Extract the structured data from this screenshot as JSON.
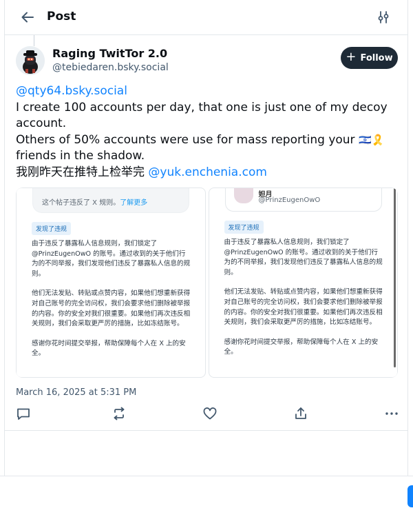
{
  "header": {
    "title": "Post",
    "back_icon": "arrow-left-icon",
    "settings_icon": "sliders-icon"
  },
  "author": {
    "name": "Raging TwitTor 2.0",
    "handle": "@tebiedaren.bsky.social"
  },
  "follow": {
    "label": "Follow"
  },
  "post": {
    "mention_1": "@qty64.bsky.social",
    "line_1": "I create 100 accounts per day, that one is just one of my decoy",
    "line_2": "account.",
    "line_3": "Others of 50% accounts were use for mass reporting your ",
    "flags": "🇮🇱🎗️",
    "line_4": "friends in the shadow.",
    "line_5_prefix": "我刚昨天在推特上检举完 ",
    "mention_2": "@yuk.enchenia.com"
  },
  "images": {
    "left": {
      "notice": "这个帖子违反了 X 规则。",
      "notice_link": "了解更多",
      "tag": "发现了违规",
      "para_1": "由于违反了暴露私人信息规则，我们锁定了 @PrinzEugenOwO 的账号。通过收到的关于他们行为的不同举报，我们发现他们违反了暴露私人信息的规则。",
      "para_2": "他们无法发贴、转贴或点赞内容，如果他们想重新获得对自己账号的完全访问权，我们会要求他们删除被举报的内容。你的安全对我们很重要。如果他们再次违反相关规则，我们会采取更严厉的措施，比如冻结账号。",
      "para_3": "感谢你花时间提交举报，帮助保障每个人在 X 上的安全。"
    },
    "right": {
      "quoted_name": "妲月",
      "quoted_handle": "@PrinzEugenOwO",
      "tag": "发现了违规",
      "para_1": "由于违反了暴露私人信息规则，我们锁定了 @PrinzEugenOwO 的账号。通过收到的关于他们行为的不同举报，我们发现他们违反了暴露私人信息的规则。",
      "para_2": "他们无法发贴、转贴或点赞内容，如果他们想重新获得对自己账号的完全访问权，我们会要求他们删除被举报的内容。你的安全对我们很重要。如果他们再次违反相关规则，我们会采取更严厉的措施，比如冻结账号。",
      "para_3": "感谢你花时间提交举报，帮助保障每个人在 X 上的安全。"
    }
  },
  "timestamp": "March 16, 2025 at 5:31 PM",
  "actions": {
    "icons": [
      "reply-icon",
      "repost-icon",
      "like-icon",
      "share-icon",
      "more-icon"
    ]
  },
  "colors": {
    "accent": "#1083fe",
    "follow_bg": "#1e2a36",
    "muted": "#42576c"
  }
}
